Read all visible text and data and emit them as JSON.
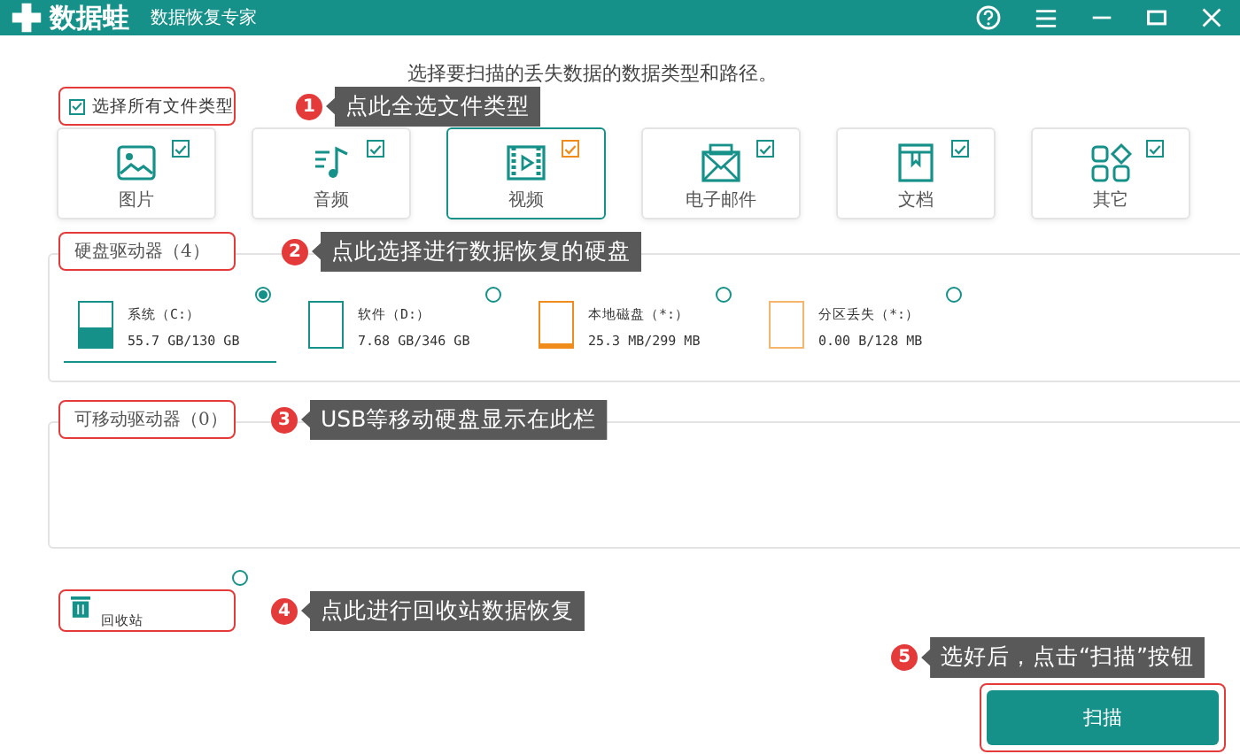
{
  "window": {
    "title": "数据蛙",
    "subtitle": "数据恢复专家"
  },
  "heading": "选择要扫描的丢失数据的数据类型和路径。",
  "select_all": {
    "label": "选择所有文件类型",
    "checked": true
  },
  "file_types": [
    {
      "label": "图片",
      "kind": "image",
      "checked": true,
      "selected": false
    },
    {
      "label": "音频",
      "kind": "audio",
      "checked": true,
      "selected": false
    },
    {
      "label": "视频",
      "kind": "video",
      "checked": true,
      "selected": true
    },
    {
      "label": "电子邮件",
      "kind": "email",
      "checked": true,
      "selected": false
    },
    {
      "label": "文档",
      "kind": "document",
      "checked": true,
      "selected": false
    },
    {
      "label": "其它",
      "kind": "other",
      "checked": true,
      "selected": false
    }
  ],
  "hard_drives": {
    "title": "硬盘驱动器（4）",
    "items": [
      {
        "name": "系统（C:）",
        "usage": "55.7 GB/130 GB",
        "color": "#16918a",
        "level": 0.43,
        "selected": true
      },
      {
        "name": "软件（D:）",
        "usage": "7.68 GB/346 GB",
        "color": "#16918a",
        "level": 0.02,
        "selected": false
      },
      {
        "name": "本地磁盘（*:）",
        "usage": "25.3 MB/299 MB",
        "color": "#f08c1c",
        "level": 0.08,
        "selected": false
      },
      {
        "name": "分区丢失（*:）",
        "usage": "0.00  B/128 MB",
        "color": "#f5b56b",
        "level": 0,
        "selected": false
      }
    ]
  },
  "removable_drives": {
    "title": "可移动驱动器（0）"
  },
  "recycle_bin": {
    "label": "回收站",
    "selected": false
  },
  "scan_button": "扫描",
  "annotations": [
    {
      "number": "1",
      "text": "点此全选文件类型"
    },
    {
      "number": "2",
      "text": "点此选择进行数据恢复的硬盘"
    },
    {
      "number": "3",
      "text": "USB等移动硬盘显示在此栏"
    },
    {
      "number": "4",
      "text": "点此进行回收站数据恢复"
    },
    {
      "number": "5",
      "text": "选好后，点击“扫描”按钮"
    }
  ]
}
